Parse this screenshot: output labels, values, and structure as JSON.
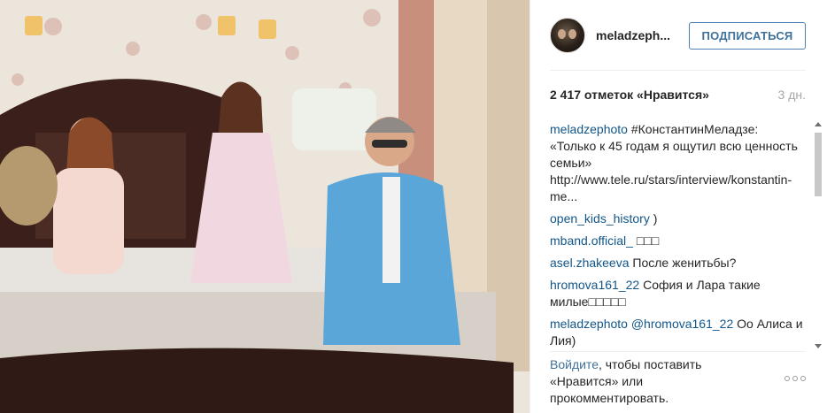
{
  "header": {
    "username": "meladzeph...",
    "follow_label": "ПОДПИСАТЬСЯ"
  },
  "stats": {
    "likes": "2 417 отметок «Нравится»",
    "time": "3 дн."
  },
  "comments": [
    {
      "user": "meladzephoto",
      "text": "#КонстантинМеладзе: «Только к 45 годам я ощутил всю ценность семьи» http://www.tele.ru/stars/interview/konstantin-me..."
    },
    {
      "user": "open_kids_history",
      "text": ")"
    },
    {
      "user": "mband.official_",
      "text": "□□□"
    },
    {
      "user": "asel.zhakeeva",
      "text": "После женитьбы?"
    },
    {
      "user": "hromova161_22",
      "text": "София и Лара такие милые□□□□□"
    },
    {
      "user": "meladzephoto",
      "mention": "@hromova161_22",
      "text": "Оо Алиса и Лия)"
    }
  ],
  "footer": {
    "login_link": "Войдите",
    "login_text": ", чтобы поставить «Нравится» или прокомментировать."
  },
  "colors": {
    "link": "#125688",
    "button": "#3f729b",
    "muted": "#a5a7aa"
  }
}
